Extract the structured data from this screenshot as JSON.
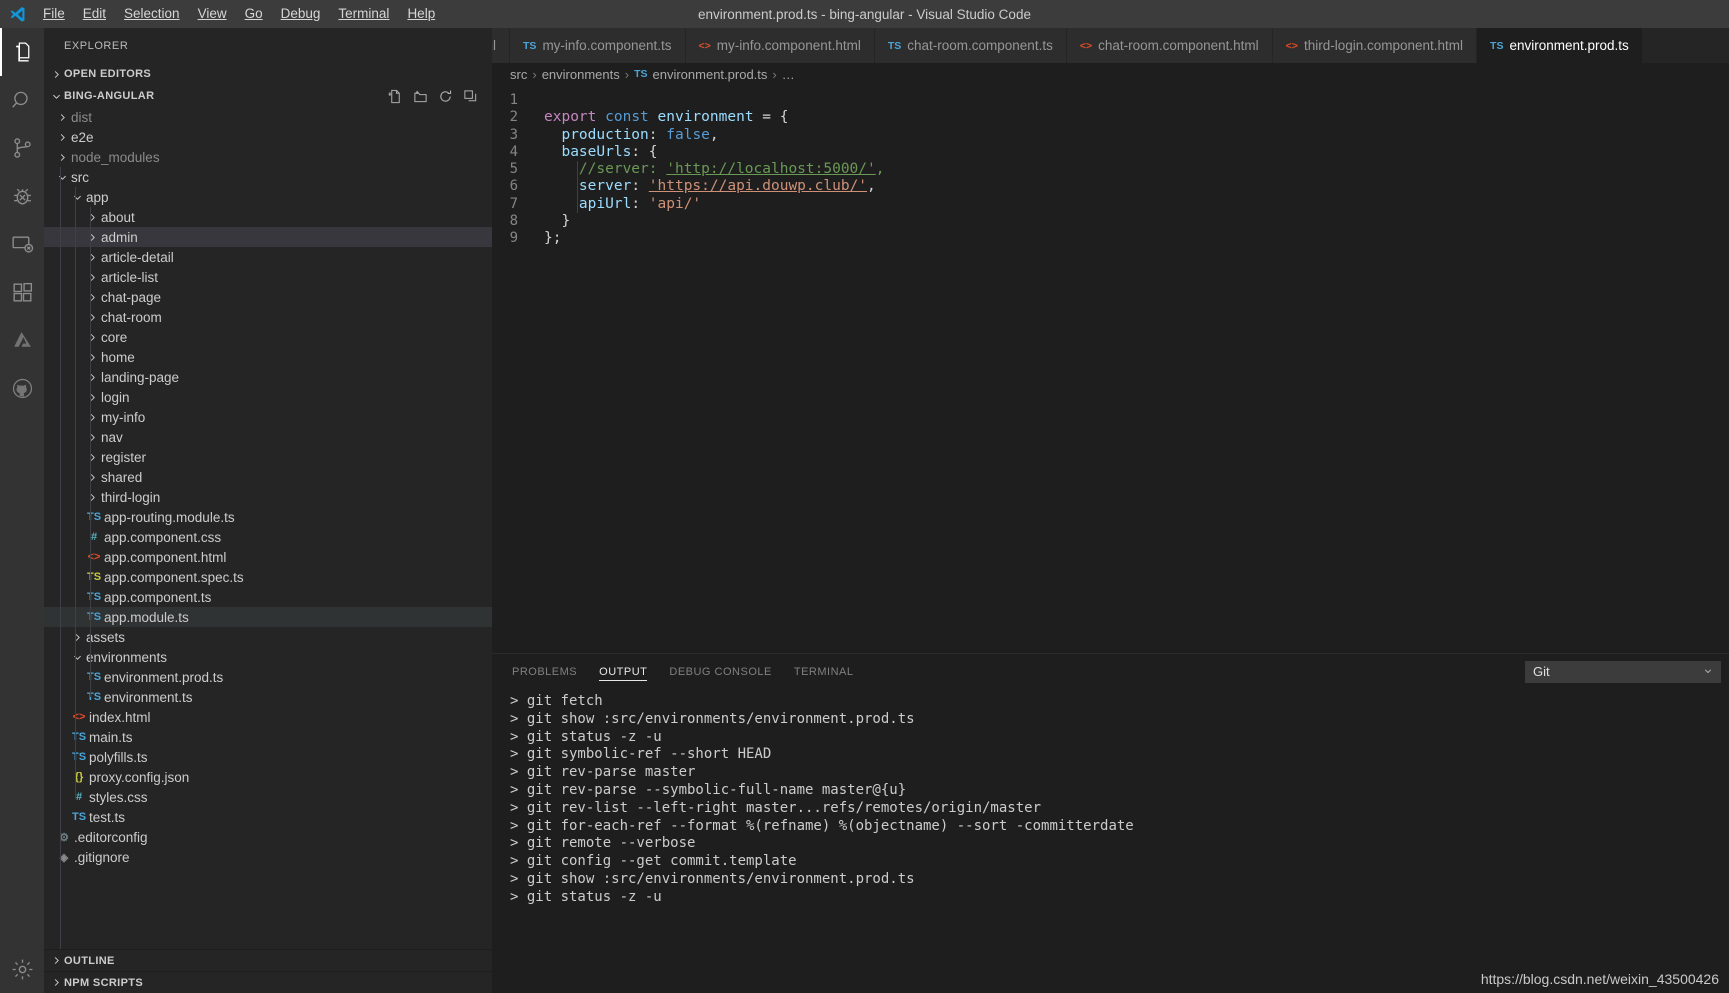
{
  "window": {
    "title": "environment.prod.ts - bing-angular - Visual Studio Code",
    "logo_name": "vscode-logo"
  },
  "menubar": [
    {
      "label": "File"
    },
    {
      "label": "Edit"
    },
    {
      "label": "Selection"
    },
    {
      "label": "View"
    },
    {
      "label": "Go"
    },
    {
      "label": "Debug"
    },
    {
      "label": "Terminal"
    },
    {
      "label": "Help"
    }
  ],
  "activitybar": {
    "items": [
      {
        "name": "explorer-icon",
        "title": "Explorer",
        "active": true
      },
      {
        "name": "search-icon",
        "title": "Search",
        "active": false
      },
      {
        "name": "source-control-icon",
        "title": "Source Control",
        "active": false
      },
      {
        "name": "debug-icon",
        "title": "Debug",
        "active": false
      },
      {
        "name": "remote-explorer-icon",
        "title": "Remote Explorer",
        "active": false
      },
      {
        "name": "extensions-icon",
        "title": "Extensions",
        "active": false
      },
      {
        "name": "azure-icon",
        "title": "Azure",
        "active": false
      },
      {
        "name": "github-icon",
        "title": "GitHub",
        "active": false
      }
    ],
    "bottom": {
      "name": "settings-gear-icon",
      "title": "Manage"
    }
  },
  "sidebar": {
    "title": "EXPLORER",
    "open_editors": {
      "label": "OPEN EDITORS",
      "expanded": false
    },
    "project": {
      "label": "BING-ANGULAR",
      "expanded": true
    },
    "project_actions": [
      {
        "name": "new-file-icon"
      },
      {
        "name": "new-folder-icon"
      },
      {
        "name": "refresh-icon"
      },
      {
        "name": "collapse-all-icon"
      }
    ],
    "tree": [
      {
        "label": "dist",
        "type": "folder",
        "depth": 1,
        "expanded": false,
        "dim": true
      },
      {
        "label": "e2e",
        "type": "folder",
        "depth": 1,
        "expanded": false,
        "dim": false
      },
      {
        "label": "node_modules",
        "type": "folder",
        "depth": 1,
        "expanded": false,
        "dim": true
      },
      {
        "label": "src",
        "type": "folder",
        "depth": 1,
        "expanded": true,
        "dim": false
      },
      {
        "label": "app",
        "type": "folder",
        "depth": 2,
        "expanded": true,
        "dim": false
      },
      {
        "label": "about",
        "type": "folder",
        "depth": 3,
        "expanded": false,
        "dim": false
      },
      {
        "label": "admin",
        "type": "folder",
        "depth": 3,
        "expanded": false,
        "dim": false,
        "selected": true
      },
      {
        "label": "article-detail",
        "type": "folder",
        "depth": 3,
        "expanded": false,
        "dim": false
      },
      {
        "label": "article-list",
        "type": "folder",
        "depth": 3,
        "expanded": false,
        "dim": false
      },
      {
        "label": "chat-page",
        "type": "folder",
        "depth": 3,
        "expanded": false,
        "dim": false
      },
      {
        "label": "chat-room",
        "type": "folder",
        "depth": 3,
        "expanded": false,
        "dim": false
      },
      {
        "label": "core",
        "type": "folder",
        "depth": 3,
        "expanded": false,
        "dim": false
      },
      {
        "label": "home",
        "type": "folder",
        "depth": 3,
        "expanded": false,
        "dim": false
      },
      {
        "label": "landing-page",
        "type": "folder",
        "depth": 3,
        "expanded": false,
        "dim": false
      },
      {
        "label": "login",
        "type": "folder",
        "depth": 3,
        "expanded": false,
        "dim": false
      },
      {
        "label": "my-info",
        "type": "folder",
        "depth": 3,
        "expanded": false,
        "dim": false
      },
      {
        "label": "nav",
        "type": "folder",
        "depth": 3,
        "expanded": false,
        "dim": false
      },
      {
        "label": "register",
        "type": "folder",
        "depth": 3,
        "expanded": false,
        "dim": false
      },
      {
        "label": "shared",
        "type": "folder",
        "depth": 3,
        "expanded": false,
        "dim": false
      },
      {
        "label": "third-login",
        "type": "folder",
        "depth": 3,
        "expanded": false,
        "dim": false
      },
      {
        "label": "app-routing.module.ts",
        "type": "ts",
        "depth": 3,
        "dim": false
      },
      {
        "label": "app.component.css",
        "type": "css",
        "depth": 3,
        "dim": false
      },
      {
        "label": "app.component.html",
        "type": "html",
        "depth": 3,
        "dim": false
      },
      {
        "label": "app.component.spec.ts",
        "type": "ts-spec",
        "depth": 3,
        "dim": false
      },
      {
        "label": "app.component.ts",
        "type": "ts",
        "depth": 3,
        "dim": false
      },
      {
        "label": "app.module.ts",
        "type": "ts",
        "depth": 3,
        "dim": false,
        "focused": true
      },
      {
        "label": "assets",
        "type": "folder",
        "depth": 2,
        "expanded": false,
        "dim": false
      },
      {
        "label": "environments",
        "type": "folder",
        "depth": 2,
        "expanded": true,
        "dim": false
      },
      {
        "label": "environment.prod.ts",
        "type": "ts",
        "depth": 3,
        "dim": false
      },
      {
        "label": "environment.ts",
        "type": "ts",
        "depth": 3,
        "dim": false
      },
      {
        "label": "index.html",
        "type": "html",
        "depth": 2,
        "dim": false
      },
      {
        "label": "main.ts",
        "type": "ts",
        "depth": 2,
        "dim": false
      },
      {
        "label": "polyfills.ts",
        "type": "ts",
        "depth": 2,
        "dim": false
      },
      {
        "label": "proxy.config.json",
        "type": "json",
        "depth": 2,
        "dim": false
      },
      {
        "label": "styles.css",
        "type": "css",
        "depth": 2,
        "dim": false
      },
      {
        "label": "test.ts",
        "type": "ts",
        "depth": 2,
        "dim": false
      },
      {
        "label": ".editorconfig",
        "type": "config",
        "depth": 1,
        "dim": false
      },
      {
        "label": ".gitignore",
        "type": "git",
        "depth": 1,
        "dim": false
      }
    ],
    "bottom_sections": [
      {
        "label": "OUTLINE",
        "expanded": false
      },
      {
        "label": "NPM SCRIPTS",
        "expanded": false
      }
    ]
  },
  "editor": {
    "tabs": [
      {
        "label": "t.html",
        "icon": "",
        "icon_type": "none",
        "active": false
      },
      {
        "label": "my-info.component.ts",
        "icon": "TS",
        "icon_type": "ts",
        "active": false
      },
      {
        "label": "my-info.component.html",
        "icon": "<>",
        "icon_type": "html",
        "active": false
      },
      {
        "label": "chat-room.component.ts",
        "icon": "TS",
        "icon_type": "ts",
        "active": false
      },
      {
        "label": "chat-room.component.html",
        "icon": "<>",
        "icon_type": "html",
        "active": false
      },
      {
        "label": "third-login.component.html",
        "icon": "<>",
        "icon_type": "html",
        "active": false
      },
      {
        "label": "environment.prod.ts",
        "icon": "TS",
        "icon_type": "ts",
        "active": true
      }
    ],
    "breadcrumb": [
      {
        "label": "src",
        "icon": ""
      },
      {
        "label": "environments",
        "icon": ""
      },
      {
        "label": "environment.prod.ts",
        "icon": "TS"
      },
      {
        "label": "…",
        "icon": ""
      }
    ],
    "filename": "environment.prod.ts",
    "lines": [
      {
        "n": 1,
        "tokens": []
      },
      {
        "n": 2,
        "tokens": [
          {
            "t": "export",
            "c": "kw-purple"
          },
          {
            "t": " ",
            "c": "punct"
          },
          {
            "t": "const",
            "c": "kw-blue"
          },
          {
            "t": " ",
            "c": "punct"
          },
          {
            "t": "environment",
            "c": "ident-lblue"
          },
          {
            "t": " = {",
            "c": "punct"
          }
        ]
      },
      {
        "n": 3,
        "tokens": [
          {
            "t": "  ",
            "c": "punct"
          },
          {
            "t": "production",
            "c": "ident-lblue"
          },
          {
            "t": ": ",
            "c": "punct"
          },
          {
            "t": "false",
            "c": "kw-blue"
          },
          {
            "t": ",",
            "c": "punct"
          }
        ]
      },
      {
        "n": 4,
        "tokens": [
          {
            "t": "  ",
            "c": "punct"
          },
          {
            "t": "baseUrls",
            "c": "ident-lblue"
          },
          {
            "t": ": {",
            "c": "punct"
          }
        ]
      },
      {
        "n": 5,
        "tokens": [
          {
            "t": "    ",
            "c": "punct"
          },
          {
            "t": "//server: ",
            "c": "comment-green"
          },
          {
            "t": "'http://localhost:5000/'",
            "c": "comment-green link-u"
          },
          {
            "t": ",",
            "c": "comment-green"
          }
        ]
      },
      {
        "n": 6,
        "tokens": [
          {
            "t": "    ",
            "c": "punct"
          },
          {
            "t": "server",
            "c": "ident-lblue"
          },
          {
            "t": ": ",
            "c": "punct"
          },
          {
            "t": "'https://api.douwp.club/'",
            "c": "str-orange link-u"
          },
          {
            "t": ",",
            "c": "punct"
          }
        ]
      },
      {
        "n": 7,
        "tokens": [
          {
            "t": "    ",
            "c": "punct"
          },
          {
            "t": "apiUrl",
            "c": "ident-lblue"
          },
          {
            "t": ": ",
            "c": "punct"
          },
          {
            "t": "'api/'",
            "c": "str-orange"
          }
        ]
      },
      {
        "n": 8,
        "tokens": [
          {
            "t": "  }",
            "c": "punct"
          }
        ]
      },
      {
        "n": 9,
        "tokens": [
          {
            "t": "};",
            "c": "punct"
          }
        ]
      }
    ]
  },
  "panel": {
    "tabs": [
      {
        "label": "PROBLEMS",
        "active": false
      },
      {
        "label": "OUTPUT",
        "active": true
      },
      {
        "label": "DEBUG CONSOLE",
        "active": false
      },
      {
        "label": "TERMINAL",
        "active": false
      }
    ],
    "channel_select": {
      "value": "Git",
      "chevron": "chevron-down-icon"
    },
    "output_lines": [
      "> git fetch",
      "> git show :src/environments/environment.prod.ts",
      "> git status -z -u",
      "> git symbolic-ref --short HEAD",
      "> git rev-parse master",
      "> git rev-parse --symbolic-full-name master@{u}",
      "> git rev-list --left-right master...refs/remotes/origin/master",
      "> git for-each-ref --format %(refname) %(objectname) --sort -committerdate",
      "> git remote --verbose",
      "> git config --get commit.template",
      "> git show :src/environments/environment.prod.ts",
      "> git status -z -u"
    ]
  },
  "watermark": "https://blog.csdn.net/weixin_43500426",
  "colors": {
    "titlebar_bg": "#3c3c3c",
    "activitybar_bg": "#333333",
    "sidebar_bg": "#252526",
    "editor_bg": "#1e1e1e",
    "tab_inactive_bg": "#2d2d2d",
    "selection_bg": "#37373d",
    "accent_blue": "#4ba4d8",
    "string_orange": "#ce9178",
    "comment_green": "#6a9955",
    "keyword_purple": "#c586c0",
    "keyword_blue": "#569cd6",
    "variable_lightblue": "#9cdcfe"
  }
}
